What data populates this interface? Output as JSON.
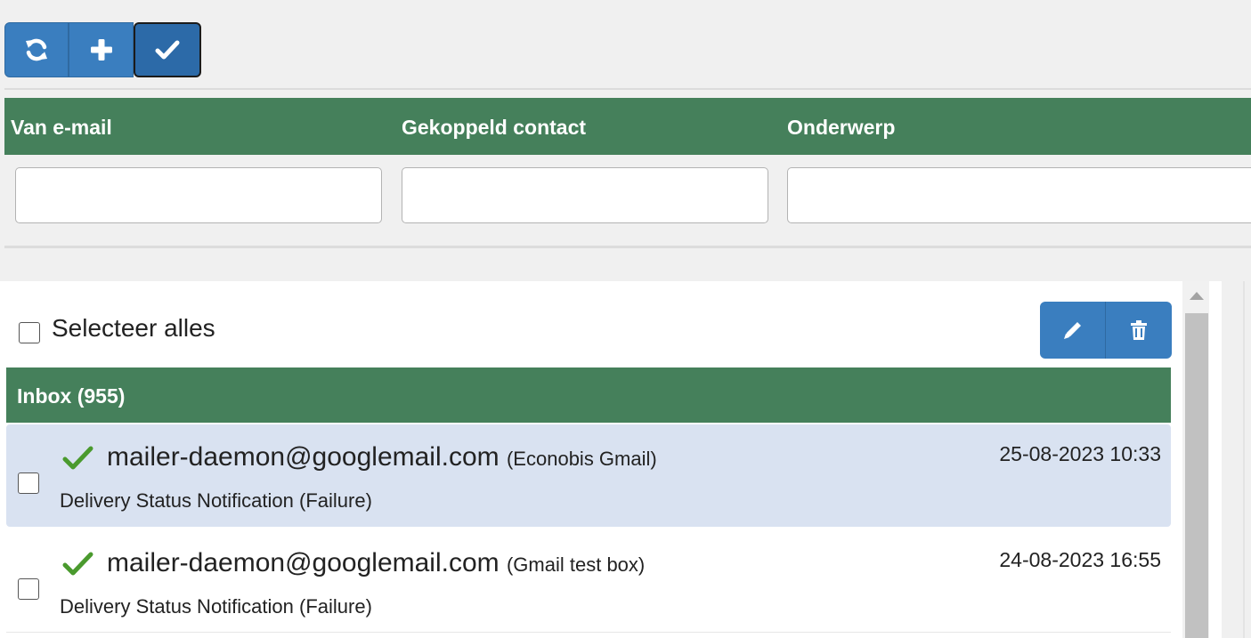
{
  "toolbar": {
    "buttons": [
      {
        "icon": "refresh-icon"
      },
      {
        "icon": "plus-icon"
      },
      {
        "icon": "check-icon",
        "active": true
      }
    ]
  },
  "filters": {
    "columns": [
      "Van e-mail",
      "Gekoppeld contact",
      "Onderwerp"
    ],
    "inputs": [
      {
        "value": "",
        "placeholder": ""
      },
      {
        "value": "",
        "placeholder": ""
      },
      {
        "value": "",
        "placeholder": ""
      }
    ]
  },
  "list": {
    "select_all_label": "Selecteer alles",
    "actions": [
      {
        "icon": "pencil-icon"
      },
      {
        "icon": "trash-icon"
      }
    ],
    "folder_title": "Inbox (955)",
    "rows": [
      {
        "from": "mailer-daemon@googlemail.com",
        "mailbox": "(Econobis Gmail)",
        "subject": "Delivery Status Notification (Failure)",
        "date": "25-08-2023 10:33",
        "selected": true
      },
      {
        "from": "mailer-daemon@googlemail.com",
        "mailbox": "(Gmail test box)",
        "subject": "Delivery Status Notification (Failure)",
        "date": "24-08-2023 16:55",
        "selected": false
      }
    ]
  },
  "colors": {
    "primary_blue": "#3a7ebf",
    "header_green": "#45805b",
    "selected_row": "#d9e2f1",
    "check_green": "#4a9a2e"
  }
}
